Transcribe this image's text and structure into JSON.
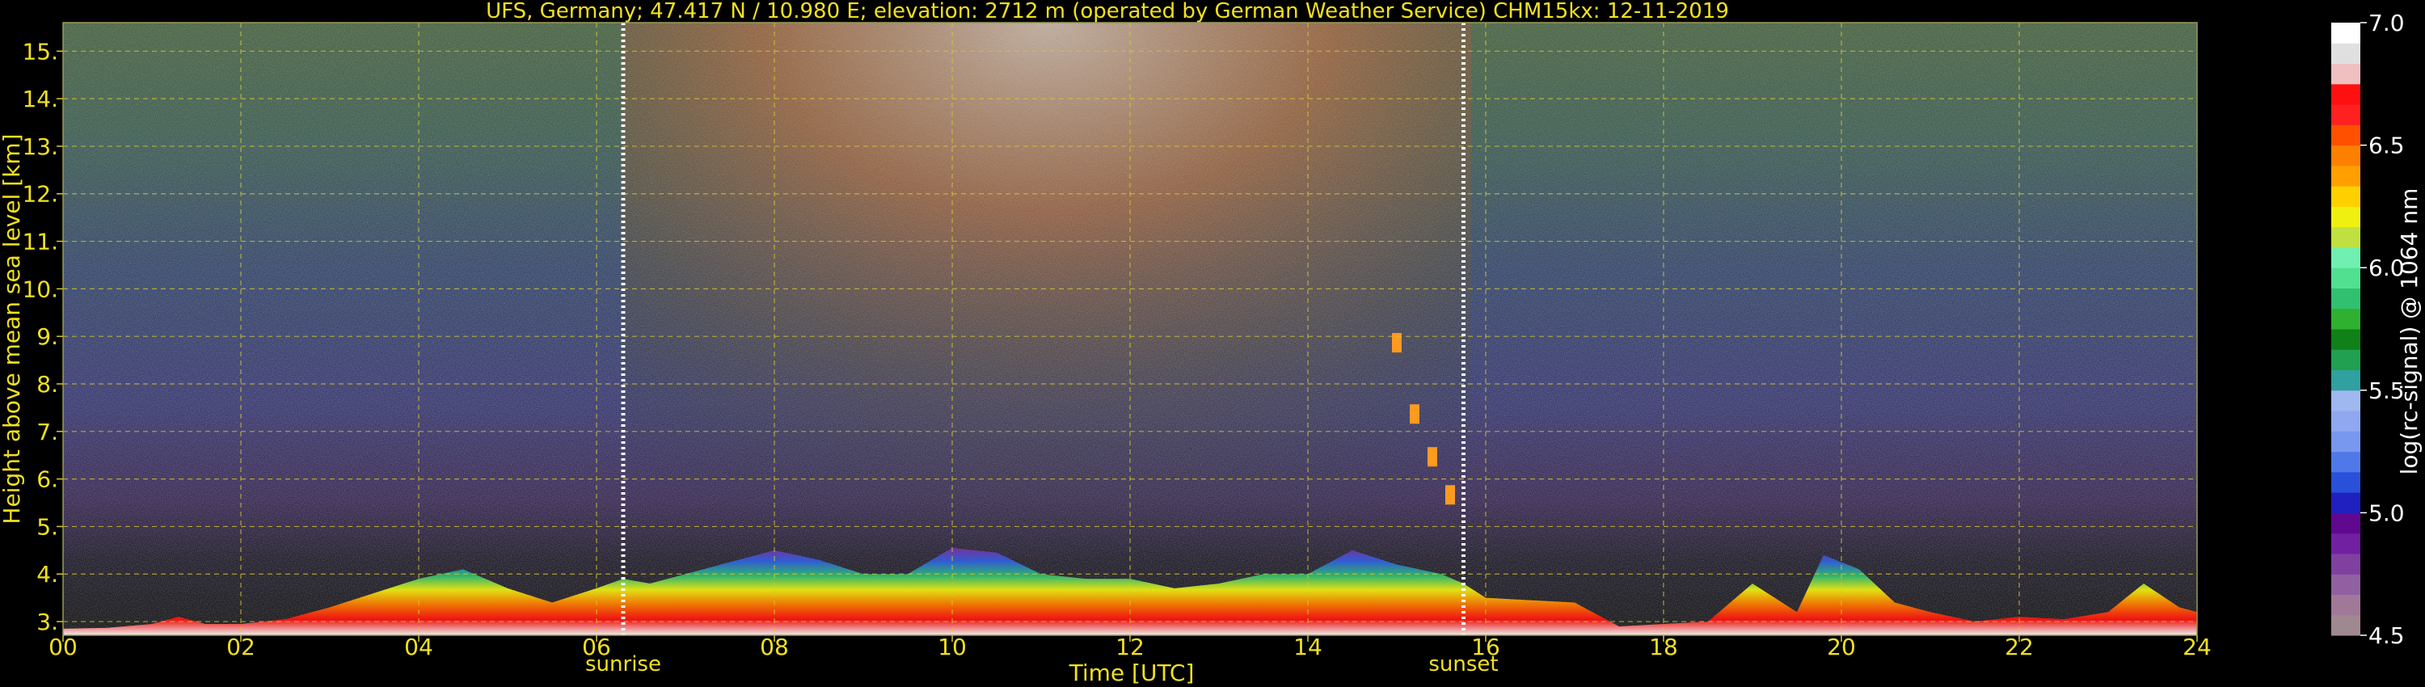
{
  "chart_data": {
    "type": "heatmap",
    "title": "UFS, Germany; 47.417 N / 10.980 E; elevation: 2712 m  (operated by German Weather Service)    CHM15kx: 12-11-2019",
    "xlabel": "Time [UTC]",
    "ylabel": "Height above mean sea level [km]",
    "xlim": [
      0,
      24
    ],
    "ylim": [
      2.712,
      15.6
    ],
    "x_ticks": [
      {
        "value": 0,
        "label": "00"
      },
      {
        "value": 2,
        "label": "02"
      },
      {
        "value": 4,
        "label": "04"
      },
      {
        "value": 6,
        "label": "06"
      },
      {
        "value": 8,
        "label": "08"
      },
      {
        "value": 10,
        "label": "10"
      },
      {
        "value": 12,
        "label": "12"
      },
      {
        "value": 14,
        "label": "14"
      },
      {
        "value": 16,
        "label": "16"
      },
      {
        "value": 18,
        "label": "18"
      },
      {
        "value": 20,
        "label": "20"
      },
      {
        "value": 22,
        "label": "22"
      },
      {
        "value": 24,
        "label": "24"
      }
    ],
    "y_ticks": [
      {
        "value": 3,
        "label": "3."
      },
      {
        "value": 4,
        "label": "4."
      },
      {
        "value": 5,
        "label": "5."
      },
      {
        "value": 6,
        "label": "6."
      },
      {
        "value": 7,
        "label": "7."
      },
      {
        "value": 8,
        "label": "8."
      },
      {
        "value": 9,
        "label": "9."
      },
      {
        "value": 10,
        "label": "10."
      },
      {
        "value": 11,
        "label": "11."
      },
      {
        "value": 12,
        "label": "12."
      },
      {
        "value": 13,
        "label": "13."
      },
      {
        "value": 14,
        "label": "14."
      },
      {
        "value": 15,
        "label": "15."
      }
    ],
    "grid": true,
    "annotations": [
      {
        "label": "sunrise",
        "x": 6.3
      },
      {
        "label": "sunset",
        "x": 15.75
      }
    ],
    "colorbar": {
      "label": "log(rc-signal) @ 1064 nm",
      "range": [
        4.5,
        7.0
      ],
      "ticks": [
        {
          "value": 4.5,
          "label": "4.5"
        },
        {
          "value": 5.0,
          "label": "5.0"
        },
        {
          "value": 5.5,
          "label": "5.5"
        },
        {
          "value": 6.0,
          "label": "6.0"
        },
        {
          "value": 6.5,
          "label": "6.5"
        },
        {
          "value": 7.0,
          "label": "7.0"
        }
      ],
      "colors": [
        "#a08890",
        "#a07898",
        "#9060a0",
        "#8040a0",
        "#7020a0",
        "#600890",
        "#2020c0",
        "#2850d8",
        "#5078e8",
        "#7898f0",
        "#90a8f0",
        "#a0b8f0",
        "#30a0a0",
        "#20a050",
        "#108018",
        "#30b030",
        "#30c070",
        "#50e090",
        "#70f0b0",
        "#c0e040",
        "#f0f010",
        "#ffd000",
        "#ffa000",
        "#ff8000",
        "#ff5000",
        "#ff2020",
        "#ff1010",
        "#f0c0c0",
        "#e0e0e0",
        "#ffffff"
      ]
    },
    "layers": [
      {
        "name": "boundary-layer",
        "x": [
          0,
          0.5,
          1,
          1.3,
          1.6,
          2,
          2.5,
          3,
          3.5,
          4,
          4.5,
          5,
          5.5,
          6,
          6.3,
          6.6,
          7,
          7.5,
          8,
          8.5,
          9,
          9.5,
          10,
          10.5,
          11,
          11.5,
          12,
          12.5,
          13,
          13.5,
          14,
          14.5,
          15,
          15.5,
          15.75,
          16,
          16.5,
          17,
          17.5,
          18,
          18.5,
          19,
          19.5,
          19.8,
          20.2,
          20.6,
          21,
          21.5,
          22,
          22.5,
          23,
          23.4,
          23.8,
          24
        ],
        "top": [
          2.85,
          2.87,
          2.95,
          3.1,
          2.95,
          2.95,
          3.05,
          3.3,
          3.6,
          3.9,
          4.1,
          3.7,
          3.4,
          3.7,
          3.9,
          3.8,
          4.0,
          4.25,
          4.5,
          4.3,
          4.0,
          4.0,
          4.55,
          4.45,
          4.0,
          3.9,
          3.9,
          3.7,
          3.8,
          4.0,
          4.0,
          4.5,
          4.2,
          4.0,
          3.8,
          3.5,
          3.45,
          3.4,
          2.9,
          2.95,
          3.0,
          3.8,
          3.2,
          4.4,
          4.1,
          3.4,
          3.2,
          3.0,
          3.1,
          3.05,
          3.2,
          3.8,
          3.3,
          3.2
        ]
      },
      {
        "name": "elevated-aerosol",
        "x": [
          15.0,
          15.2,
          15.4,
          15.6
        ],
        "top": [
          8.9,
          7.4,
          6.5,
          5.7
        ]
      }
    ]
  }
}
